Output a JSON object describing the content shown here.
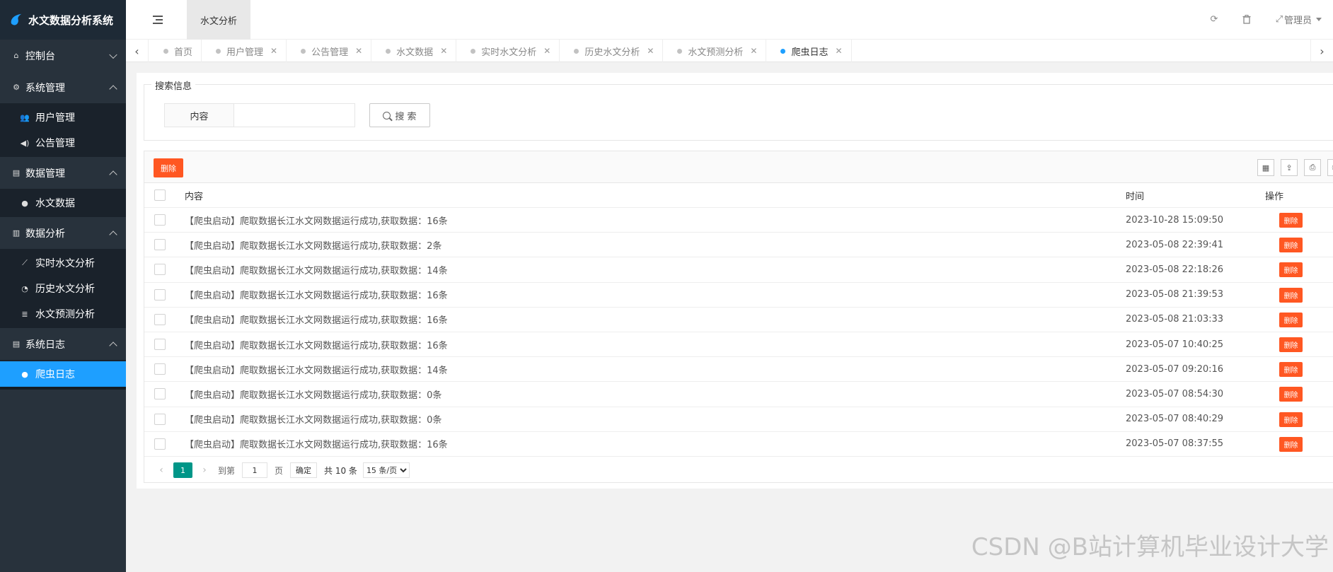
{
  "app": {
    "title": "水文数据分析系统"
  },
  "sidebar": {
    "groups": [
      {
        "label": "控制台",
        "icon": "home-icon",
        "expanded": false,
        "items": []
      },
      {
        "label": "系统管理",
        "icon": "gears-icon",
        "expanded": true,
        "items": [
          {
            "label": "用户管理",
            "icon": "users-icon"
          },
          {
            "label": "公告管理",
            "icon": "volume-icon"
          }
        ]
      },
      {
        "label": "数据管理",
        "icon": "table-icon",
        "expanded": true,
        "items": [
          {
            "label": "水文数据",
            "icon": "globe-icon"
          }
        ]
      },
      {
        "label": "数据分析",
        "icon": "bar-chart-icon",
        "expanded": true,
        "items": [
          {
            "label": "实时水文分析",
            "icon": "line-chart-icon"
          },
          {
            "label": "历史水文分析",
            "icon": "pie-chart-icon"
          },
          {
            "label": "水文预测分析",
            "icon": "database-icon"
          }
        ]
      },
      {
        "label": "系统日志",
        "icon": "table-icon",
        "expanded": true,
        "items": [
          {
            "label": "爬虫日志",
            "icon": "globe-icon",
            "active": true
          }
        ]
      }
    ]
  },
  "header": {
    "module_tab": "水文分析",
    "user": "管理员"
  },
  "tabs": [
    {
      "label": "首页",
      "closable": false
    },
    {
      "label": "用户管理",
      "closable": true
    },
    {
      "label": "公告管理",
      "closable": true
    },
    {
      "label": "水文数据",
      "closable": true
    },
    {
      "label": "实时水文分析",
      "closable": true
    },
    {
      "label": "历史水文分析",
      "closable": true
    },
    {
      "label": "水文预测分析",
      "closable": true
    },
    {
      "label": "爬虫日志",
      "closable": true,
      "active": true
    }
  ],
  "search": {
    "legend": "搜索信息",
    "field_label": "内容",
    "field_value": "",
    "button_label": "搜 索"
  },
  "table": {
    "delete_button": "删除",
    "columns": {
      "content": "内容",
      "time": "时间",
      "op": "操作"
    },
    "row_delete_label": "删除",
    "rows": [
      {
        "content": "【爬虫启动】爬取数据长江水文网数据运行成功,获取数据：16条",
        "time": "2023-10-28 15:09:50"
      },
      {
        "content": "【爬虫启动】爬取数据长江水文网数据运行成功,获取数据：2条",
        "time": "2023-05-08 22:39:41"
      },
      {
        "content": "【爬虫启动】爬取数据长江水文网数据运行成功,获取数据：14条",
        "time": "2023-05-08 22:18:26"
      },
      {
        "content": "【爬虫启动】爬取数据长江水文网数据运行成功,获取数据：16条",
        "time": "2023-05-08 21:39:53"
      },
      {
        "content": "【爬虫启动】爬取数据长江水文网数据运行成功,获取数据：16条",
        "time": "2023-05-08 21:03:33"
      },
      {
        "content": "【爬虫启动】爬取数据长江水文网数据运行成功,获取数据：16条",
        "time": "2023-05-07 10:40:25"
      },
      {
        "content": "【爬虫启动】爬取数据长江水文网数据运行成功,获取数据：14条",
        "time": "2023-05-07 09:20:16"
      },
      {
        "content": "【爬虫启动】爬取数据长江水文网数据运行成功,获取数据：0条",
        "time": "2023-05-07 08:54:30"
      },
      {
        "content": "【爬虫启动】爬取数据长江水文网数据运行成功,获取数据：0条",
        "time": "2023-05-07 08:40:29"
      },
      {
        "content": "【爬虫启动】爬取数据长江水文网数据运行成功,获取数据：16条",
        "time": "2023-05-07 08:37:55"
      }
    ]
  },
  "pager": {
    "current": "1",
    "goto_label": "到第",
    "goto_value": "1",
    "page_unit": "页",
    "ok_label": "确定",
    "total": "共 10 条",
    "page_size": "15 条/页"
  },
  "watermark": "CSDN @B站计算机毕业设计大学"
}
